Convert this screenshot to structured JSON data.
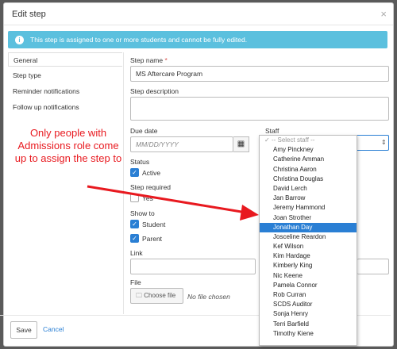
{
  "modal": {
    "title": "Edit step",
    "close_symbol": "×"
  },
  "banner": {
    "icon": "info-icon",
    "text": "This step is assigned to one or more students and cannot be fully edited."
  },
  "sidenav": {
    "items": [
      {
        "label": "General",
        "active": true
      },
      {
        "label": "Step type",
        "active": false
      },
      {
        "label": "Reminder notifications",
        "active": false
      },
      {
        "label": "Follow up notifications",
        "active": false
      }
    ]
  },
  "form": {
    "step_name_label": "Step name",
    "step_name_required": "*",
    "step_name_value": "MS Aftercare Program",
    "step_description_label": "Step description",
    "due_date_label": "Due date",
    "due_date_placeholder": "MM/DD/YYYY",
    "staff_label": "Staff",
    "status_label": "Status",
    "status_active_label": "Active",
    "status_active_checked": true,
    "step_required_label": "Step required",
    "step_required_yes_label": "Yes",
    "step_required_checked": false,
    "show_to_label": "Show to",
    "show_student_label": "Student",
    "show_student_checked": true,
    "show_parent_label": "Parent",
    "show_parent_checked": true,
    "link_label": "Link",
    "file_label": "File",
    "choose_file_label": "Choose file",
    "no_file_label": "No file chosen"
  },
  "staff_dropdown": {
    "placeholder": "-- Select staff --",
    "options": [
      "Amy Pinckney",
      "Catherine Amman",
      "Christina Aaron",
      "Christina Douglas",
      "David Lerch",
      "Jan Barrow",
      "Jeremy Hammond",
      "Joan Strother",
      "Jonathan Day",
      "Josceline Reardon",
      "Kef Wilson",
      "Kim Hardage",
      "Kimberly King",
      "Nic Keene",
      "Pamela Connor",
      "Rob Curran",
      "SCDS Auditor",
      "Sonja Henry",
      "Terri Barfield",
      "Timothy Kiene"
    ],
    "selected": "Jonathan Day"
  },
  "footer": {
    "save_label": "Save",
    "cancel_label": "Cancel"
  },
  "annotation": {
    "text": "Only people with Admissions role come up to assign the step to",
    "color": "#e8191f"
  },
  "colors": {
    "accent": "#2a7fd4",
    "banner": "#5bc0de"
  }
}
